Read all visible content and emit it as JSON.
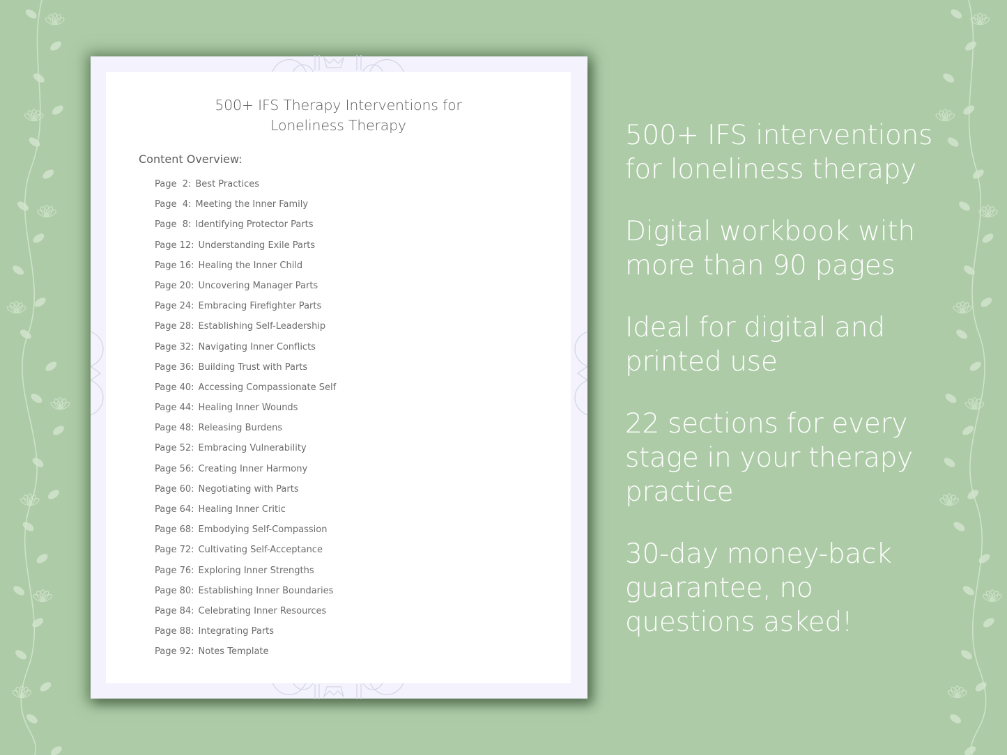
{
  "document": {
    "title_line1": "500+ IFS Therapy Interventions for",
    "title_line2": "Loneliness Therapy",
    "overview_label": "Content Overview:",
    "toc": [
      {
        "page": "Page  2:",
        "title": "Best Practices"
      },
      {
        "page": "Page  4:",
        "title": "Meeting the Inner Family"
      },
      {
        "page": "Page  8:",
        "title": "Identifying Protector Parts"
      },
      {
        "page": "Page 12:",
        "title": "Understanding Exile Parts"
      },
      {
        "page": "Page 16:",
        "title": "Healing the Inner Child"
      },
      {
        "page": "Page 20:",
        "title": "Uncovering Manager Parts"
      },
      {
        "page": "Page 24:",
        "title": "Embracing Firefighter Parts"
      },
      {
        "page": "Page 28:",
        "title": "Establishing Self-Leadership"
      },
      {
        "page": "Page 32:",
        "title": "Navigating Inner Conflicts"
      },
      {
        "page": "Page 36:",
        "title": "Building Trust with Parts"
      },
      {
        "page": "Page 40:",
        "title": "Accessing Compassionate Self"
      },
      {
        "page": "Page 44:",
        "title": "Healing Inner Wounds"
      },
      {
        "page": "Page 48:",
        "title": "Releasing Burdens"
      },
      {
        "page": "Page 52:",
        "title": "Embracing Vulnerability"
      },
      {
        "page": "Page 56:",
        "title": "Creating Inner Harmony"
      },
      {
        "page": "Page 60:",
        "title": "Negotiating with Parts"
      },
      {
        "page": "Page 64:",
        "title": "Healing Inner Critic"
      },
      {
        "page": "Page 68:",
        "title": "Embodying Self-Compassion"
      },
      {
        "page": "Page 72:",
        "title": "Cultivating Self-Acceptance"
      },
      {
        "page": "Page 76:",
        "title": "Exploring Inner Strengths"
      },
      {
        "page": "Page 80:",
        "title": "Establishing Inner Boundaries"
      },
      {
        "page": "Page 84:",
        "title": "Celebrating Inner Resources"
      },
      {
        "page": "Page 88:",
        "title": "Integrating Parts"
      },
      {
        "page": "Page 92:",
        "title": "Notes Template"
      }
    ]
  },
  "features": [
    {
      "line1": "500+ IFS interventions",
      "line2": "for loneliness therapy"
    },
    {
      "line1": "Digital workbook with",
      "line2": "more than 90 pages"
    },
    {
      "line1": "Ideal for digital and",
      "line2": "printed use"
    },
    {
      "line1": "22 sections for every",
      "line2": "stage in your therapy",
      "line3": "practice"
    },
    {
      "line1": "30-day money-back",
      "line2": "guarantee, no",
      "line3": "questions asked!"
    }
  ],
  "colors": {
    "background": "#adcba7",
    "document_border": "#f3f2fd",
    "document_page": "#ffffff",
    "text_gray": "#5e5e5e",
    "feature_text": "#ffffff"
  },
  "icons": {
    "vine": "floral-vine-icon",
    "mandala": "mandala-ornament-icon"
  }
}
